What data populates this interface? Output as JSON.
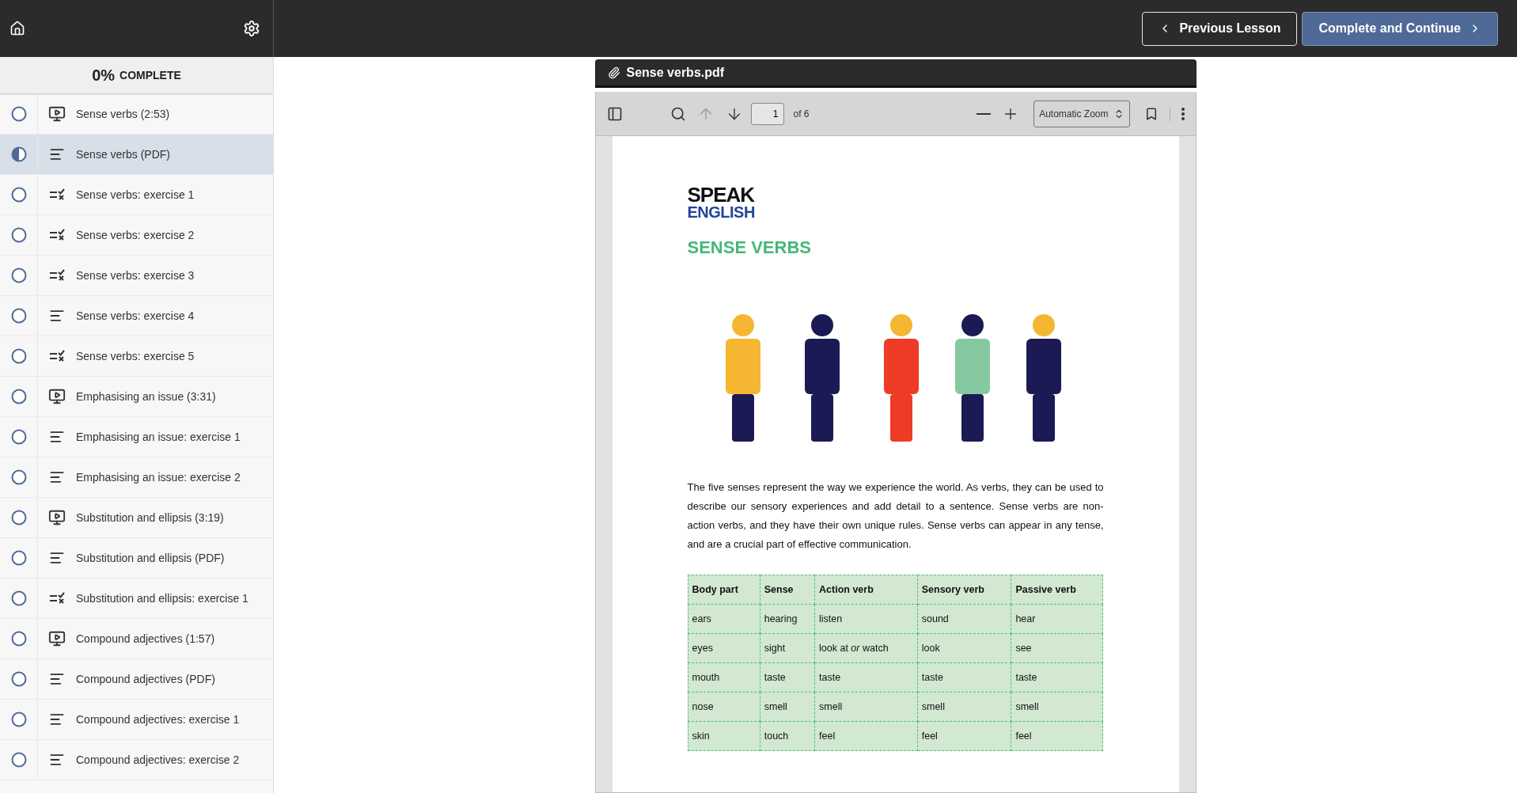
{
  "top_bar": {
    "buttons": [
      {
        "label": "Previous Lesson",
        "kind": "previous"
      },
      {
        "label": "Complete and Continue",
        "kind": "next"
      }
    ]
  },
  "sidebar": {
    "progress": {
      "percent": "0%",
      "label": "COMPLETE"
    },
    "items": [
      {
        "title": "Sense verbs (2:53)",
        "kind": "video",
        "selected": false,
        "started": false
      },
      {
        "title": "Sense verbs (PDF)",
        "kind": "text",
        "selected": true,
        "started": true
      },
      {
        "title": "Sense verbs: exercise 1",
        "kind": "quiz",
        "selected": false,
        "started": false
      },
      {
        "title": "Sense verbs: exercise 2",
        "kind": "quiz",
        "selected": false,
        "started": false
      },
      {
        "title": "Sense verbs: exercise 3",
        "kind": "quiz",
        "selected": false,
        "started": false
      },
      {
        "title": "Sense verbs: exercise 4",
        "kind": "text",
        "selected": false,
        "started": false
      },
      {
        "title": "Sense verbs: exercise 5",
        "kind": "quiz",
        "selected": false,
        "started": false
      },
      {
        "title": "Emphasising an issue (3:31)",
        "kind": "video",
        "selected": false,
        "started": false
      },
      {
        "title": "Emphasising an issue: exercise 1",
        "kind": "text",
        "selected": false,
        "started": false
      },
      {
        "title": "Emphasising an issue: exercise 2",
        "kind": "text",
        "selected": false,
        "started": false
      },
      {
        "title": "Substitution and ellipsis (3:19)",
        "kind": "video",
        "selected": false,
        "started": false
      },
      {
        "title": "Substitution and ellipsis (PDF)",
        "kind": "text",
        "selected": false,
        "started": false
      },
      {
        "title": "Substitution and ellipsis: exercise 1",
        "kind": "quiz",
        "selected": false,
        "started": false
      },
      {
        "title": "Compound adjectives (1:57)",
        "kind": "video",
        "selected": false,
        "started": false
      },
      {
        "title": "Compound adjectives (PDF)",
        "kind": "text",
        "selected": false,
        "started": false
      },
      {
        "title": "Compound adjectives: exercise 1",
        "kind": "text",
        "selected": false,
        "started": false
      },
      {
        "title": "Compound adjectives: exercise 2",
        "kind": "text",
        "selected": false,
        "started": false
      }
    ]
  },
  "viewer": {
    "file_name": "Sense verbs.pdf",
    "toolbar": {
      "page": "1",
      "page_count": "of 6",
      "zoom": "Automatic Zoom",
      "previous_page_disabled": true
    },
    "document": {
      "logo": [
        "SPEAK",
        "ENGLISH"
      ],
      "title": "SENSE VERBS",
      "paragraph": "The five senses represent the way we experience the world. As verbs, they can be used to describe our sensory experiences and add detail to a sentence. Sense verbs are non-action verbs, and they have their own unique rules. Sense verbs can appear in any tense, and are a crucial part of effective communication.",
      "table": {
        "columns": [
          "Body part",
          "Sense",
          "Action verb",
          "Sensory verb",
          "Passive verb"
        ],
        "rows": [
          [
            "ears",
            "hearing",
            "listen",
            "sound",
            "hear"
          ],
          [
            "eyes",
            "sight",
            "look at *or* watch",
            "look",
            "see"
          ],
          [
            "mouth",
            "taste",
            "taste",
            "taste",
            "taste"
          ],
          [
            "nose",
            "smell",
            "smell",
            "smell",
            "smell"
          ],
          [
            "skin",
            "touch",
            "feel",
            "feel",
            "feel"
          ]
        ]
      }
    }
  }
}
